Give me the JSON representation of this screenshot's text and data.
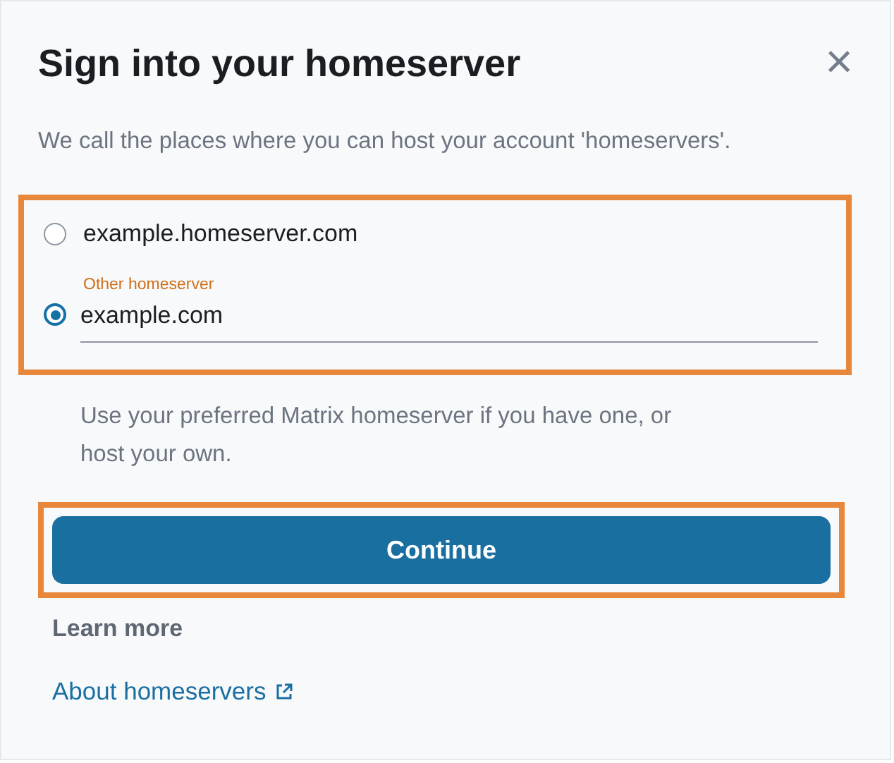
{
  "dialog": {
    "title": "Sign into your homeserver",
    "close": "×",
    "description": "We call the places where you can host your account 'homeservers'."
  },
  "options": {
    "highlighted": true,
    "items": [
      {
        "kind": "preset",
        "label": "example.homeserver.com",
        "selected": false
      },
      {
        "kind": "field",
        "floating_label": "Other homeserver",
        "value": "example.com",
        "selected": true
      }
    ]
  },
  "help": "Use your preferred Matrix homeserver if you have one, or host your own.",
  "continue_button": {
    "label": "Continue",
    "highlighted": true
  },
  "learn_more": {
    "heading": "Learn more",
    "link": "About homeservers"
  }
}
